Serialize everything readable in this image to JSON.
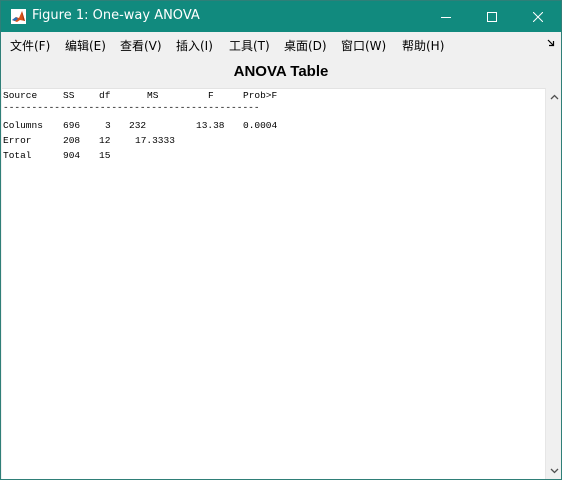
{
  "window": {
    "title": "Figure 1: One-way ANOVA",
    "accent_color": "#118a7e",
    "icon": "matlab-logo-icon"
  },
  "menu": {
    "items": [
      "文件(F)",
      "编辑(E)",
      "查看(V)",
      "插入(I)",
      "工具(T)",
      "桌面(D)",
      "窗口(W)",
      "帮助(H)"
    ],
    "overflow_icon": "dock-arrow-icon"
  },
  "panel": {
    "heading": "ANOVA Table"
  },
  "table": {
    "header": [
      "Source",
      "SS",
      "df",
      "MS",
      "F",
      "Prob>F"
    ],
    "separator": "---------------------------------------------",
    "rows": [
      [
        "Columns",
        "696",
        "3",
        "232",
        "13.38",
        "0.0004"
      ],
      [
        "Error",
        "208",
        "12",
        "17.3333",
        "",
        ""
      ],
      [
        "Total",
        "904",
        "15",
        "",
        "",
        ""
      ]
    ]
  }
}
